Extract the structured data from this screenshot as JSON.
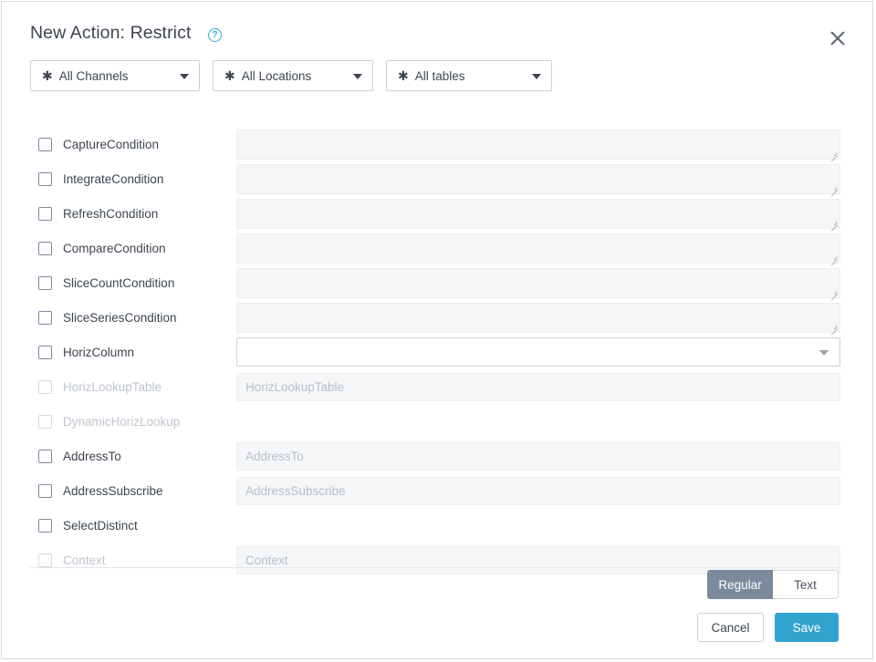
{
  "dialog": {
    "title": "New Action: Restrict",
    "help_icon": "help-circle-icon",
    "help_glyph": "?",
    "close_icon": "close-icon"
  },
  "filters": [
    {
      "star": "✱",
      "label": "All Channels"
    },
    {
      "star": "✱",
      "label": "All Locations"
    },
    {
      "star": "✱",
      "label": "All tables"
    }
  ],
  "rows": [
    {
      "label": "CaptureCondition",
      "checked": false,
      "disabled": false,
      "field": "textarea",
      "placeholder": ""
    },
    {
      "label": "IntegrateCondition",
      "checked": false,
      "disabled": false,
      "field": "textarea",
      "placeholder": ""
    },
    {
      "label": "RefreshCondition",
      "checked": false,
      "disabled": false,
      "field": "textarea",
      "placeholder": ""
    },
    {
      "label": "CompareCondition",
      "checked": false,
      "disabled": false,
      "field": "textarea",
      "placeholder": ""
    },
    {
      "label": "SliceCountCondition",
      "checked": false,
      "disabled": false,
      "field": "textarea",
      "placeholder": ""
    },
    {
      "label": "SliceSeriesCondition",
      "checked": false,
      "disabled": false,
      "field": "textarea",
      "placeholder": ""
    },
    {
      "label": "HorizColumn",
      "checked": false,
      "disabled": false,
      "field": "select",
      "value": ""
    },
    {
      "label": "HorizLookupTable",
      "checked": false,
      "disabled": true,
      "field": "text",
      "placeholder": "HorizLookupTable"
    },
    {
      "label": "DynamicHorizLookup",
      "checked": false,
      "disabled": true,
      "field": "none"
    },
    {
      "label": "AddressTo",
      "checked": false,
      "disabled": false,
      "field": "text",
      "placeholder": "AddressTo"
    },
    {
      "label": "AddressSubscribe",
      "checked": false,
      "disabled": false,
      "field": "text",
      "placeholder": "AddressSubscribe"
    },
    {
      "label": "SelectDistinct",
      "checked": false,
      "disabled": false,
      "field": "none"
    },
    {
      "label": "Context",
      "checked": false,
      "disabled": true,
      "field": "text",
      "placeholder": "Context"
    }
  ],
  "footer": {
    "toggles": [
      {
        "label": "Regular",
        "active": true
      },
      {
        "label": "Text",
        "active": false
      }
    ],
    "cancel_label": "Cancel",
    "save_label": "Save"
  },
  "colors": {
    "accent_blue": "#31a3cf",
    "toggle_active": "#7c8a9e",
    "text": "#3d4551",
    "muted_text": "#bfc5cd",
    "field_fill": "#f4f6f8",
    "border": "#ccd0d6"
  }
}
